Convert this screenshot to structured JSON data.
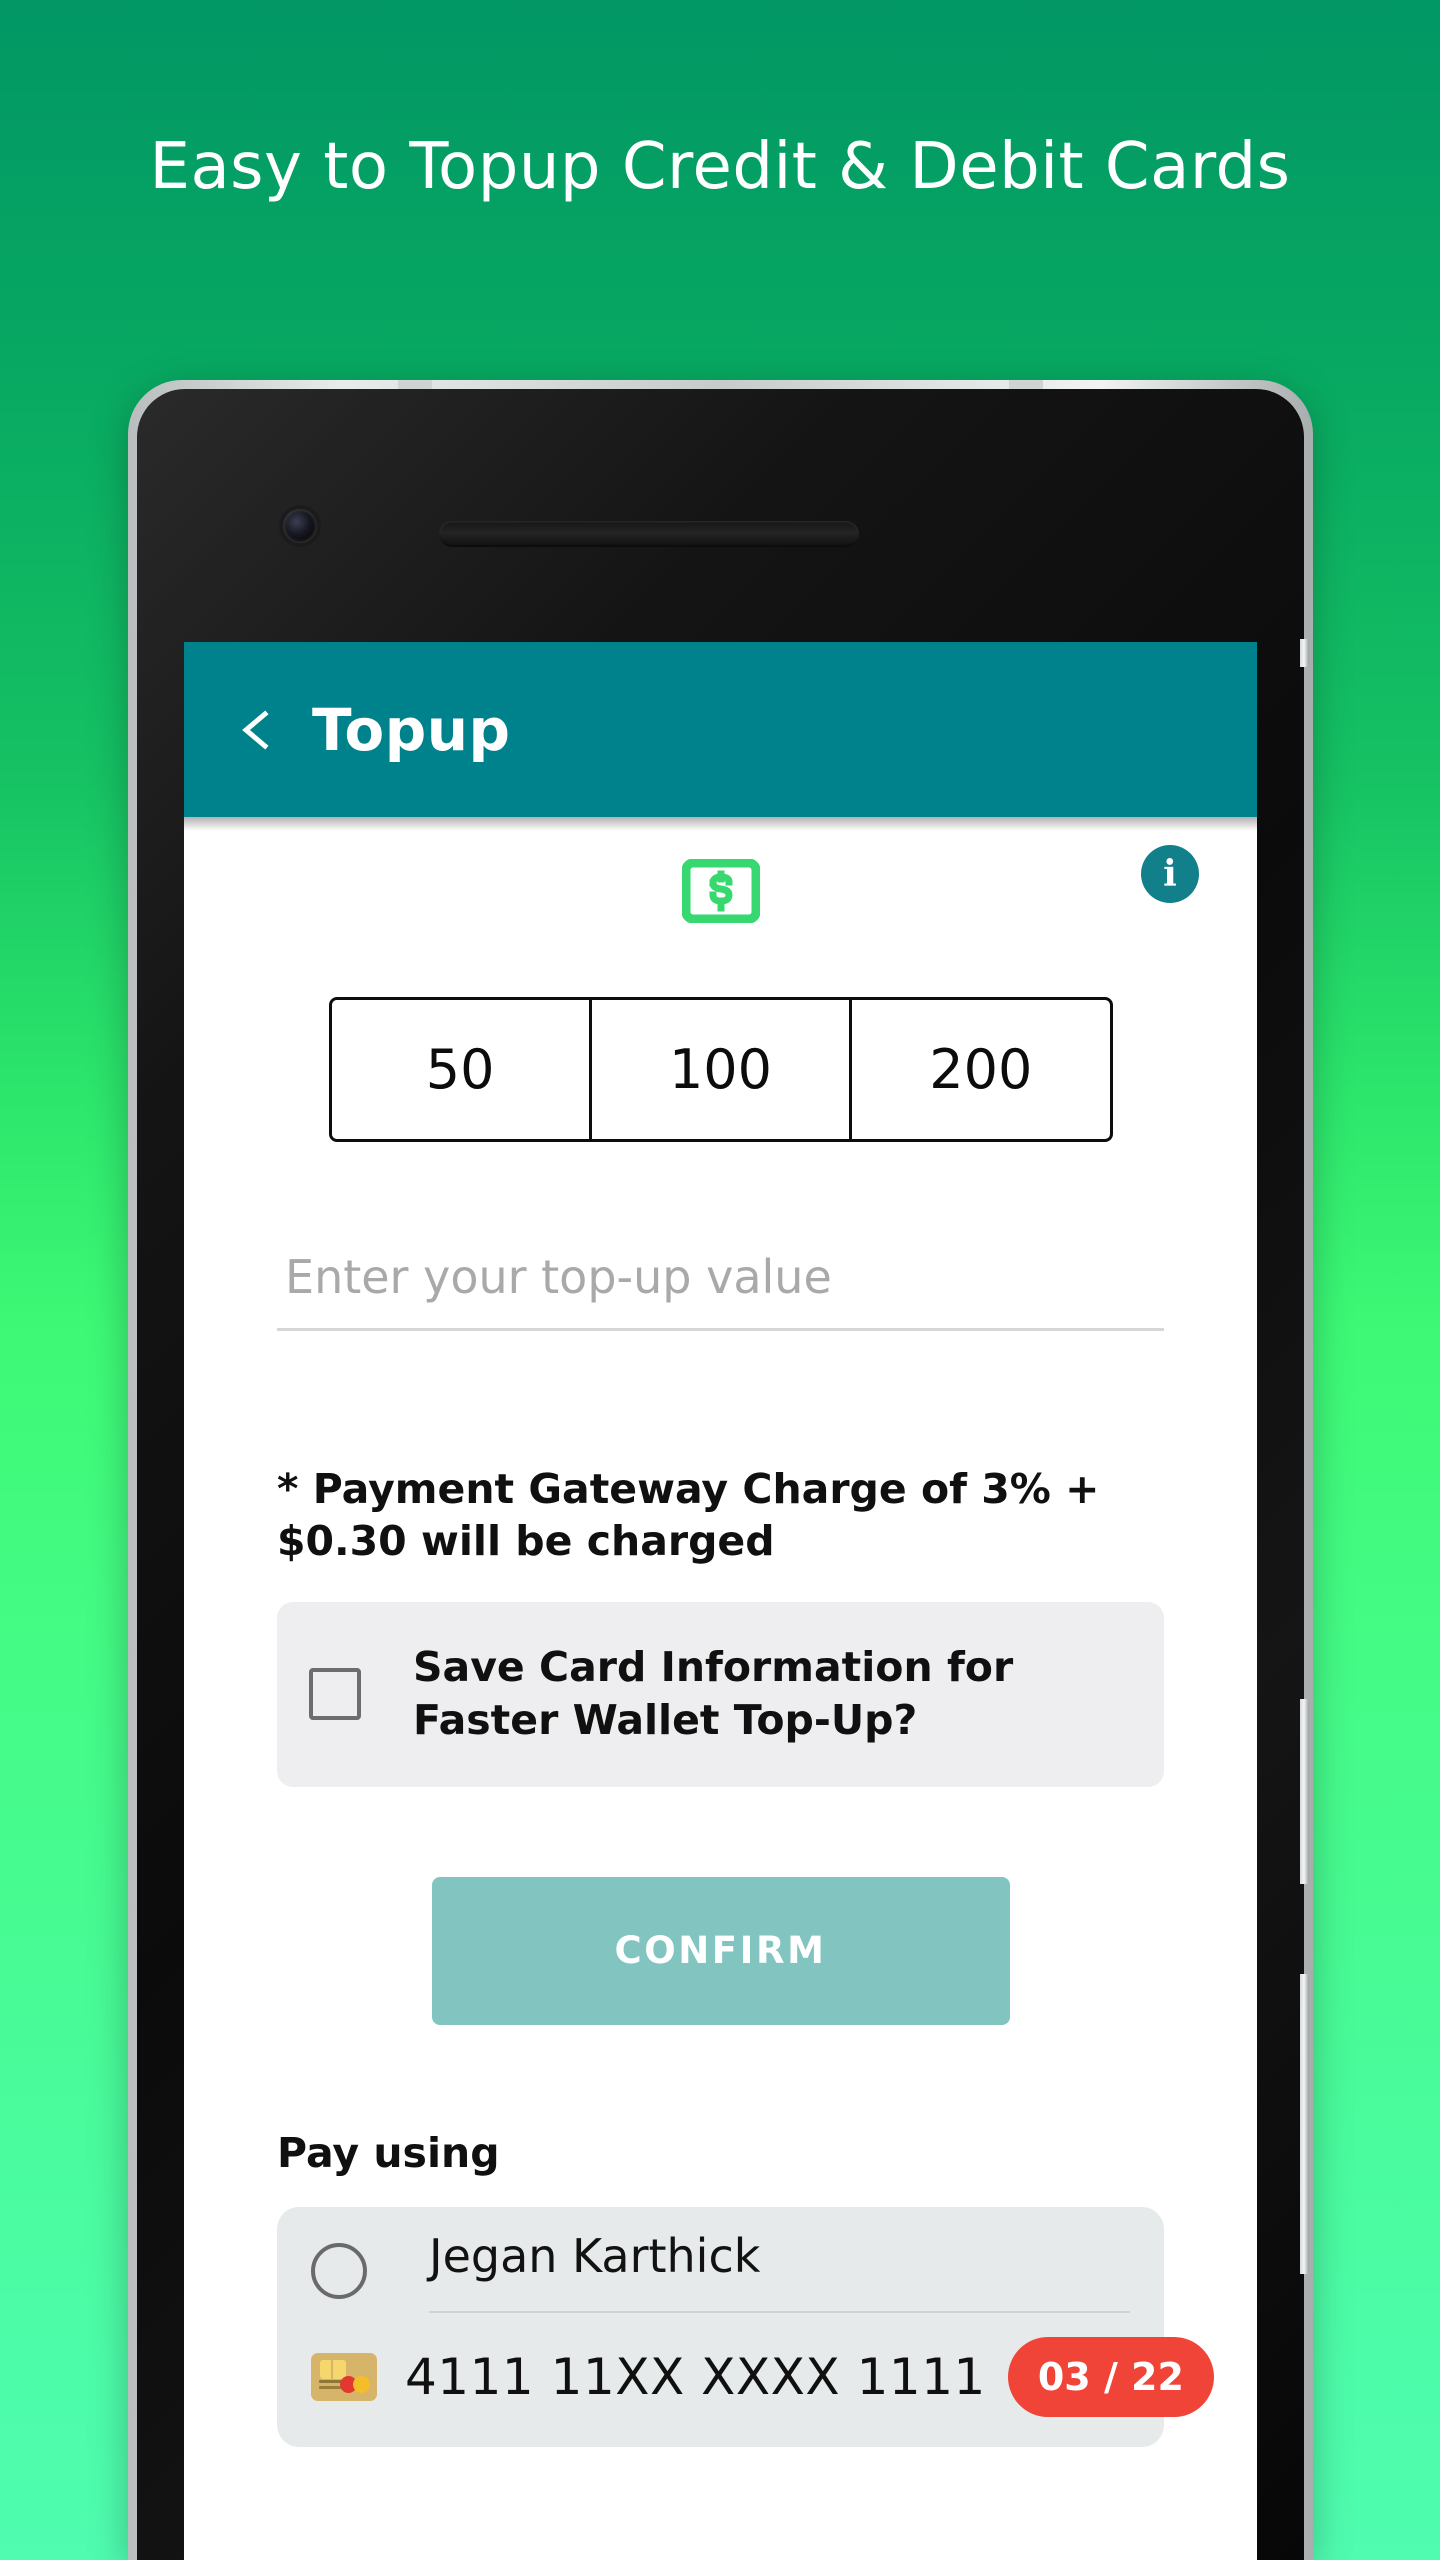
{
  "promo": {
    "headline": "Easy to Topup Credit & Debit Cards"
  },
  "colors": {
    "bg_top": "#029765",
    "bg_bottom": "#4FFCB0",
    "appbar": "#00828C",
    "money_icon": "#36D86F",
    "info_icon": "#12808A",
    "confirm": "#82C5C0",
    "badge": "#F04438"
  },
  "appbar": {
    "back_label": "Back",
    "title": "Topup"
  },
  "topup": {
    "money_icon_name": "money-note-icon",
    "info_icon_name": "info-icon",
    "info_label": "i",
    "quick_amounts": [
      "50",
      "100",
      "200"
    ],
    "amount_input": {
      "value": "",
      "placeholder": "Enter your top-up value"
    },
    "gateway_note": "* Payment Gateway Charge of 3% + $0.30 will be charged",
    "save_card": {
      "label": "Save Card Information for Faster Wallet Top-Up?",
      "checked": false
    },
    "confirm_label": "CONFIRM"
  },
  "pay_using": {
    "section_label": "Pay using",
    "methods": [
      {
        "selected": false,
        "holder_name": "Jegan Karthick",
        "card_number": "4111 11XX XXXX 1111",
        "expiry": "03 / 22",
        "brand_icon": "credit-card-icon"
      }
    ]
  }
}
